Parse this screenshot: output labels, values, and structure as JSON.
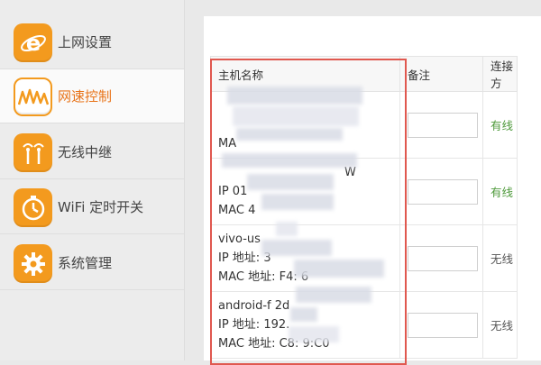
{
  "sidebar": {
    "items": [
      {
        "label": "上网设置",
        "icon": "ie-globe-icon",
        "active": false
      },
      {
        "label": "网速控制",
        "icon": "speed-wave-icon",
        "active": true
      },
      {
        "label": "无线中继",
        "icon": "wireless-relay-icon",
        "active": false
      },
      {
        "label": "WiFi 定时开关",
        "icon": "timer-icon",
        "active": false
      },
      {
        "label": "系统管理",
        "icon": "gear-icon",
        "active": false
      }
    ]
  },
  "table": {
    "headers": {
      "host": "主机名称",
      "note": "备注",
      "connection": "连接方"
    },
    "rows": [
      {
        "host_lines": [
          "",
          "",
          "MA"
        ],
        "note": "",
        "connection": "有线",
        "connection_type": "wired"
      },
      {
        "host_lines": [
          "W",
          "IP 01",
          "MAC 4"
        ],
        "note": "",
        "connection": "有线",
        "connection_type": "wired"
      },
      {
        "host_lines": [
          "vivo-us",
          "IP 地址: 3",
          "MAC 地址: F4: 6"
        ],
        "note": "",
        "connection": "无线",
        "connection_type": "wireless"
      },
      {
        "host_lines": [
          "android-f 2d",
          "IP 地址: 192.",
          "MAC 地址: C8: 9:C0"
        ],
        "note": "",
        "connection": "无线",
        "connection_type": "wireless"
      }
    ]
  },
  "colors": {
    "accent": "#f39a1e",
    "active_text": "#e8741a",
    "wired": "#4f9a3c",
    "highlight": "#e0584f"
  }
}
